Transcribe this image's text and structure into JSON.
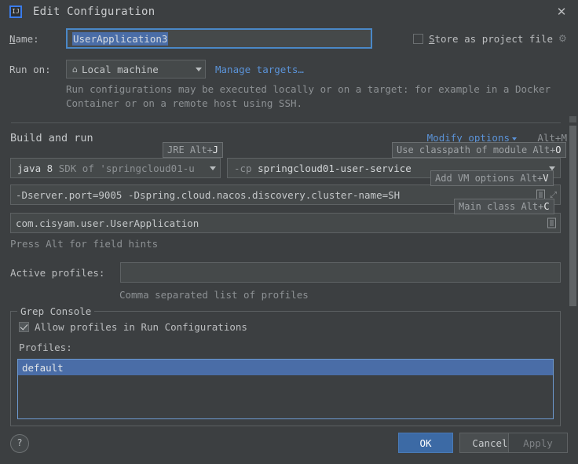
{
  "window": {
    "title": "Edit Configuration",
    "logo_icon": "intellij-idea-logo",
    "close_icon": "✕"
  },
  "name_row": {
    "label": "Name:",
    "value": "UserApplication3",
    "store_as_project_file_label": "Store as project file",
    "store_checked": false,
    "gear_icon": "⚙"
  },
  "run_on": {
    "label": "Run on:",
    "target_icon": "⌂",
    "target_value": "Local machine",
    "manage_targets_link": "Manage targets…",
    "description": "Run configurations may be executed locally or on a target: for example in a Docker Container or on a remote host using SSH."
  },
  "build_and_run": {
    "section_title": "Build and run",
    "modify_options_label": "Modify options",
    "modify_options_shortcut": "Alt+M",
    "hints": {
      "jre": "JRE Alt+J",
      "jre_text": "JRE Alt+",
      "jre_key": "J",
      "classpath_text": "Use classpath of module Alt+",
      "classpath_key": "O",
      "vm_text": "Add VM options Alt+",
      "vm_key": "V",
      "main_class_text": "Main class Alt+",
      "main_class_key": "C"
    },
    "sdk_name": "java 8",
    "sdk_description": "SDK of 'springcloud01-u",
    "classpath_prefix": "-cp",
    "classpath_module": "springcloud01-user-service",
    "vm_options": "-Dserver.port=9005 -Dspring.cloud.nacos.discovery.cluster-name=SH",
    "main_class": "com.cisyam.user.UserApplication",
    "alt_hints_note": "Press Alt for field hints"
  },
  "active_profiles": {
    "label": "Active profiles:",
    "value": "",
    "hint": "Comma separated list of profiles"
  },
  "grep_console": {
    "legend": "Grep Console",
    "allow_profiles_label": "Allow profiles in Run Configurations",
    "allow_profiles_checked": true,
    "profiles_label": "Profiles:",
    "items": [
      {
        "label": "default",
        "selected": true
      }
    ]
  },
  "footer": {
    "help_label": "?",
    "ok_label": "OK",
    "cancel_label": "Cancel",
    "apply_label": "Apply"
  },
  "colors": {
    "background": "#3c3f41",
    "field_background": "#45494a",
    "accent_blue": "#4a88c7",
    "link_blue": "#5b93d8",
    "selection_blue": "#4a6da7",
    "ok_button": "#3c6aa5"
  }
}
